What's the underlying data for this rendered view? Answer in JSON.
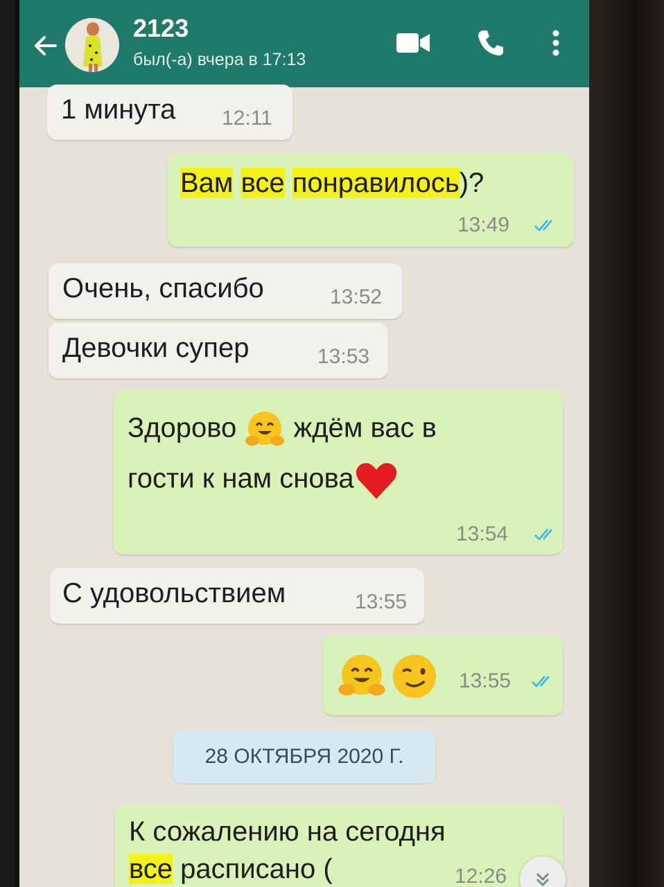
{
  "header": {
    "contact_name": "2123",
    "last_seen": "был(-а) вчера в 17:13",
    "back_icon": "arrow-left-icon",
    "video_icon": "video-camera-icon",
    "call_icon": "phone-icon",
    "menu_icon": "more-vertical-icon"
  },
  "colors": {
    "header": "#1f7a6c",
    "incoming": "#f2f1ee",
    "outgoing": "#d9f2b9",
    "read_ticks": "#34b7f1",
    "highlight": "#f3f01a"
  },
  "messages": [
    {
      "direction": "in",
      "text": "1 минута",
      "time": "12:11"
    },
    {
      "direction": "out",
      "text_parts": [
        "Вам",
        "все",
        "понравилось",
        ")?"
      ],
      "time": "13:49",
      "status": "read"
    },
    {
      "direction": "in",
      "text": "Очень,  спасибо",
      "time": "13:52"
    },
    {
      "direction": "in",
      "text": "Девочки супер",
      "time": "13:53"
    },
    {
      "direction": "out",
      "line1_a": "Здорово",
      "line1_b": "ждём вас в",
      "line2": "гости к нам снова",
      "time": "13:54",
      "status": "read",
      "emoji": [
        "hugging-face",
        "red-heart"
      ]
    },
    {
      "direction": "in",
      "text": "С удовольствием",
      "time": "13:55"
    },
    {
      "direction": "out",
      "emoji": [
        "hugging-face",
        "winking-face"
      ],
      "time": "13:55",
      "status": "read"
    },
    {
      "direction": "out",
      "line1": "К сожалению на сегодня",
      "line2_a": "все",
      "line2_b": "расписано (",
      "time": "12:26"
    }
  ],
  "date_separator": "28 ОКТЯБРЯ 2020 Г.",
  "scroll_icon": "chevron-double-down-icon"
}
